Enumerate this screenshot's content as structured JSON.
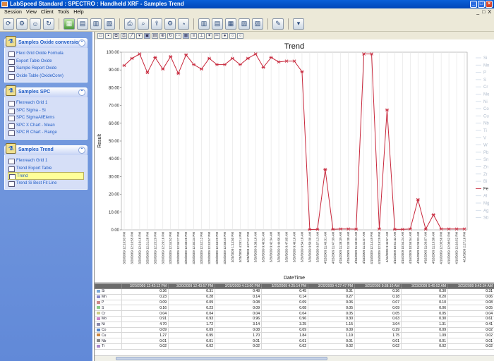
{
  "window": {
    "title": "LabSpeed Standard : SPECTRO : Handheld XRF - Samples Trend"
  },
  "menu": [
    "Session",
    "View",
    "Client",
    "Tools",
    "Help"
  ],
  "menu_right": [
    "_",
    "□",
    "X"
  ],
  "sidebar": {
    "panels": [
      {
        "title": "Samples Oxide conversion",
        "items": [
          "Flexi Grid Oxide Formula",
          "Export Table Oxide",
          "Sample Report Oxide",
          "Oxide Table (OxideConv)"
        ]
      },
      {
        "title": "Samples SPC",
        "items": [
          "Flexreach Grid 1",
          "SPC Sigma - Si",
          "SPC SigmaAllElems",
          "SPC X Chart - Mean",
          "SPC R Chart - Range"
        ]
      },
      {
        "title": "Samples Trend",
        "items": [
          "Flexreach Grid 1",
          "Trend Export Table",
          "Trend",
          "Trend Si Best Fit Line"
        ],
        "selected": "Trend"
      }
    ]
  },
  "chart_data": {
    "type": "line",
    "title": "Trend",
    "xlabel": "DateTime",
    "ylabel": "Result",
    "ylim": [
      0,
      100
    ],
    "yticks": [
      "0.00",
      "10.00",
      "20.00",
      "30.00",
      "40.00",
      "50.00",
      "60.00",
      "70.00",
      "80.00",
      "90.00",
      "100.00"
    ],
    "categories": [
      "3/20/2009 12:16:03 PM",
      "3/20/2009 12:16:55 PM",
      "3/20/2009 12:19:16 PM",
      "3/20/2009 12:21:28 PM",
      "3/20/2009 12:23:29 PM",
      "3/20/2009 12:29:16 PM",
      "3/20/2009 12:34:52 PM",
      "3/20/2009 12:36:27 PM",
      "3/20/2009 12:38:25 PM",
      "3/20/2009 12:40:34 PM",
      "3/20/2009 12:42:12 PM",
      "3/20/2009 12:43:57 PM",
      "3/20/2009 12:45:29 PM",
      "3/20/2009 12:58:49 PM",
      "3/20/2009 1:13:50 PM",
      "3/20/2009 4:25:14 PM",
      "3/20/2009 4:27:47 PM",
      "3/20/2009 9:38:10 AM",
      "3/20/2009 9:40:52 AM",
      "3/20/2009 9:42:34 AM",
      "3/20/2009 9:44:56 AM",
      "3/20/2009 9:47:05 AM",
      "3/20/2009 9:49:10 AM",
      "3/20/2009 9:54:18 AM",
      "3/20/2009 9:56:30 AM",
      "3/20/2009 9:57:13 AM",
      "4/15/2009 11:46:31 AM",
      "4/15/2009 11:47:39 AM",
      "4/15/2009 11:38:39 AM",
      "4/15/2009 11:39:30 AM",
      "4/15/2009 11:40:33 AM",
      "4/15/2009 11:41:57 AM",
      "4/15/2009 12:14:49 PM",
      "4/15/2009 12:15:29 PM",
      "4/16/2009 9:44:57 AM",
      "4/16/2009 10:51:42 AM",
      "4/16/2009 10:54:24 AM",
      "4/16/2009 10:55:54 AM",
      "4/16/2009 11:05:03 AM",
      "4/16/2009 11:09:57 AM",
      "4/16/2009 11:10:58 AM",
      "4/16/2009 12:05:56 PM",
      "4/16/2009 12:08:52 PM",
      "4/16/2009 12:10:52 PM",
      "4/16/2009 2:27:16 PM"
    ],
    "series": [
      {
        "name": "Fe",
        "color": "#c8283c",
        "values": [
          92.5,
          96.5,
          99.0,
          88.5,
          97.0,
          90.5,
          97.5,
          88.0,
          98.5,
          93.0,
          90.5,
          96.5,
          93.0,
          93.0,
          96.5,
          93.0,
          96.5,
          99.0,
          91.5,
          97.0,
          94.5,
          95.0,
          95.0,
          89.0,
          0.2,
          0.3,
          34.0,
          0.3,
          0.5,
          0.5,
          0.4,
          99.0,
          99.0,
          0.5,
          67.5,
          0.3,
          0.3,
          0.5,
          17.0,
          0.4,
          8.5,
          0.5,
          0.5,
          0.5,
          0.5
        ]
      }
    ],
    "legend": [
      "Si",
      "Mn",
      "P",
      "S",
      "Cr",
      "Mo",
      "Ni",
      "Co",
      "Cu",
      "Nb",
      "Ti",
      "V",
      "W",
      "Pb",
      "Sn",
      "Zn",
      "Zr",
      "Bi",
      "Fe",
      "Al",
      "Mg",
      "Ag",
      "Sb"
    ],
    "legend_active": "Fe",
    "legend_placement": "right"
  },
  "table": {
    "headers": [
      "",
      "3/20/2009 12:42:12 PM",
      "3/20/2009 12:43:57 PM",
      "3/20/2009 4:13:00 PM",
      "3/20/2009 4:25:14 PM",
      "3/20/2009 4:27:47 PM",
      "3/23/2009 9:38:10 AM",
      "3/23/2009 9:40:52 AM",
      "3/23/2009 9:42:34 AM"
    ],
    "rows": [
      {
        "el": "Si",
        "color": "#7aa8d8",
        "vals": [
          "0.36",
          "0.31",
          "0.48",
          "0.45",
          "0.31",
          "0.36",
          "0.30",
          "0.31"
        ]
      },
      {
        "el": "Mn",
        "color": "#88c",
        "vals": [
          "0.23",
          "0.28",
          "0.14",
          "0.14",
          "0.27",
          "0.18",
          "0.20",
          "0.06"
        ]
      },
      {
        "el": "P",
        "color": "#c88",
        "vals": [
          "0.09",
          "0.09",
          "0.08",
          "0.09",
          "0.06",
          "0.07",
          "0.10",
          "0.08"
        ]
      },
      {
        "el": "S",
        "color": "#8c8",
        "vals": [
          "0.16",
          "0.23",
          "0.09",
          "0.08",
          "0.05",
          "0.09",
          "0.06",
          "0.05"
        ]
      },
      {
        "el": "Cr",
        "color": "#cc8",
        "vals": [
          "0.04",
          "0.04",
          "0.04",
          "0.04",
          "0.05",
          "0.05",
          "0.05",
          "0.04"
        ]
      },
      {
        "el": "Mo",
        "color": "#c8c",
        "vals": [
          "0.91",
          "0.93",
          "0.96",
          "0.96",
          "0.30",
          "0.63",
          "0.30",
          "0.61"
        ]
      },
      {
        "el": "Ni",
        "color": "#88a",
        "vals": [
          "4.70",
          "1.72",
          "3.14",
          "3.25",
          "1.15",
          "3.04",
          "1.31",
          "0.41"
        ]
      },
      {
        "el": "Co",
        "color": "#58c",
        "vals": [
          "0.09",
          "0.09",
          "0.08",
          "0.09",
          "0.09",
          "0.29",
          "0.09",
          "0.02"
        ]
      },
      {
        "el": "Cu",
        "color": "#c84",
        "vals": [
          "1.27",
          "0.95",
          "1.70",
          "1.84",
          "1.19",
          "1.75",
          "1.09",
          "0.02"
        ]
      },
      {
        "el": "Nb",
        "color": "#888",
        "vals": [
          "0.01",
          "0.01",
          "0.01",
          "0.01",
          "0.01",
          "0.01",
          "0.01",
          "0.01"
        ]
      },
      {
        "el": "Ti",
        "color": "#a8c",
        "vals": [
          "0.02",
          "0.02",
          "0.02",
          "0.02",
          "0.02",
          "0.02",
          "0.02",
          "0.02"
        ]
      }
    ]
  }
}
